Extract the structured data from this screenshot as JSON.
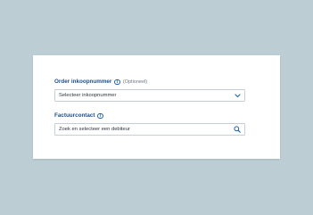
{
  "form": {
    "order_field": {
      "label": "Order inkoopnummer",
      "info_icon": "info-icon",
      "optional_text": "(Optioneel)",
      "placeholder": "Selecteer inkoopnummer",
      "icon": "chevron-down-icon"
    },
    "invoice_field": {
      "label": "Factuurcontact",
      "info_icon": "info-icon",
      "placeholder": "Zoek en selecteer een debiteur",
      "icon": "search-icon"
    }
  },
  "colors": {
    "background": "#bccdd3",
    "card": "#ffffff",
    "label": "#1b4f8a",
    "accent": "#1b5fa8",
    "border": "#c6ced6"
  }
}
